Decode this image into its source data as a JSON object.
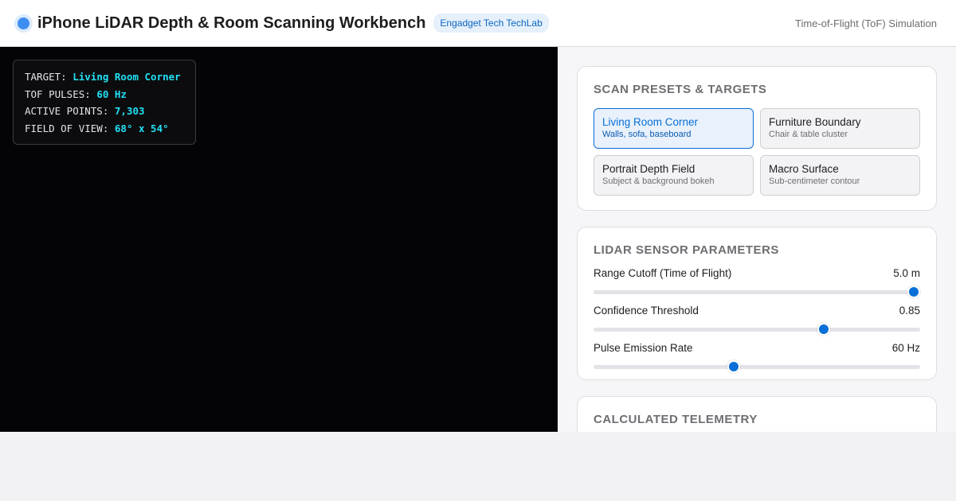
{
  "header": {
    "title": "iPhone LiDAR Depth & Room Scanning Workbench",
    "badge": "Engadget Tech TechLab",
    "mode": "Time-of-Flight (ToF) Simulation",
    "logo_color": "#3d8ef0"
  },
  "hud": {
    "target_label": "TARGET:",
    "target_value": "Living Room Corner",
    "pulses_label": "TOF PULSES:",
    "pulses_value": "60 Hz",
    "points_label": "ACTIVE POINTS:",
    "points_value": "7,303",
    "fov_label": "FIELD OF VIEW:",
    "fov_value": "68° x 54°",
    "accent_color": "#22e0f5"
  },
  "presets": {
    "title": "Scan Presets & Targets",
    "items": [
      {
        "title": "Living Room Corner",
        "subtitle": "Walls, sofa, baseboard",
        "active": true
      },
      {
        "title": "Furniture Boundary",
        "subtitle": "Chair & table cluster",
        "active": false
      },
      {
        "title": "Portrait Depth Field",
        "subtitle": "Subject & background bokeh",
        "active": false
      },
      {
        "title": "Macro Surface",
        "subtitle": "Sub-centimeter contour",
        "active": false
      }
    ]
  },
  "params": {
    "title": "LiDAR Sensor Parameters",
    "items": [
      {
        "label": "Range Cutoff (Time of Flight)",
        "value": "5.0 m",
        "fraction": 0.98
      },
      {
        "label": "Confidence Threshold",
        "value": "0.85",
        "fraction": 0.705
      },
      {
        "label": "Pulse Emission Rate",
        "value": "60 Hz",
        "fraction": 0.43
      }
    ],
    "accent_color": "#0a6fd6"
  },
  "telemetry": {
    "title": "Calculated Telemetry"
  }
}
